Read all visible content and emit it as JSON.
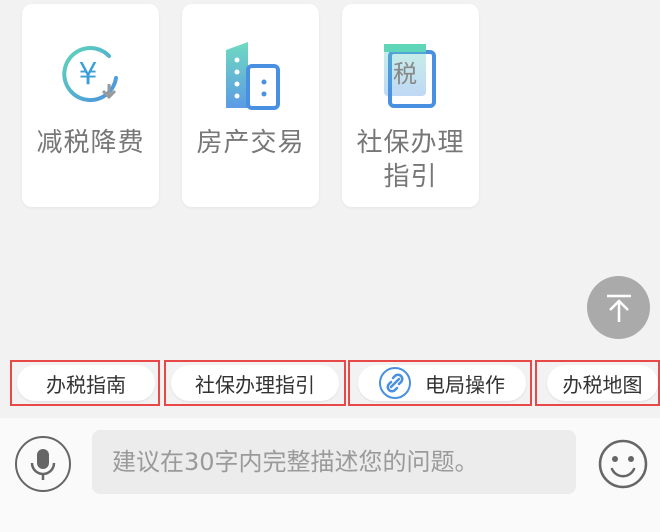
{
  "cards": [
    {
      "label": "减税降费",
      "icon": "yen-refund-icon"
    },
    {
      "label": "房产交易",
      "icon": "building-icon"
    },
    {
      "label": "社保办理指引",
      "icon": "tax-document-icon"
    }
  ],
  "chips": [
    {
      "label": "办税指南"
    },
    {
      "label": "社保办理指引"
    },
    {
      "label": "电局操作",
      "icon": "link-icon"
    },
    {
      "label": "办税地图"
    }
  ],
  "input": {
    "placeholder": "建议在30字内完整描述您的问题。"
  },
  "icons": {
    "scroll_top": "arrow-to-top-icon",
    "mic": "microphone-icon",
    "emoji": "smile-icon"
  },
  "colors": {
    "highlight_border": "#e84848",
    "icon_teal": "#3fc7b4",
    "icon_blue": "#4a90e2"
  }
}
